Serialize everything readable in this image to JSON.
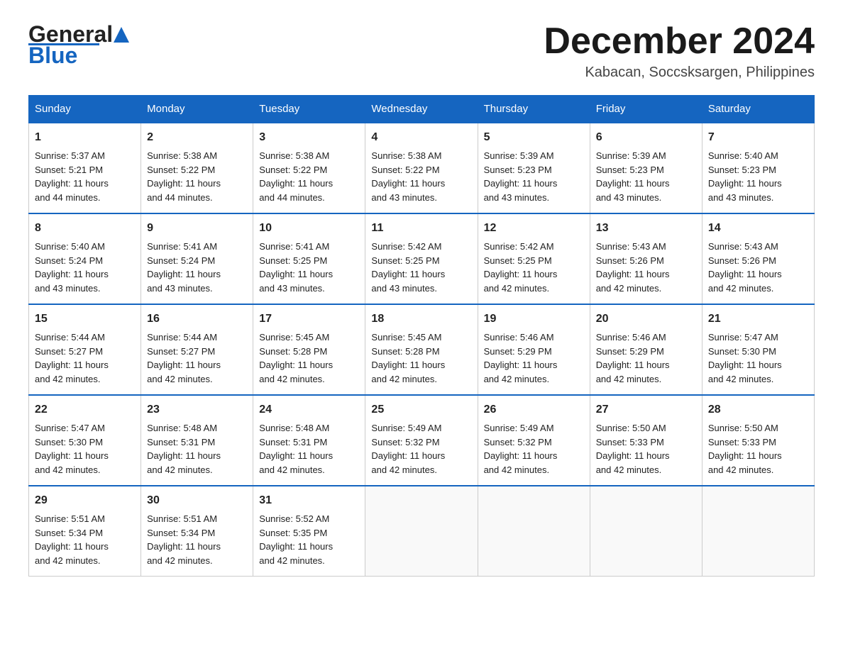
{
  "header": {
    "logo_general": "General",
    "logo_blue": "Blue",
    "month_title": "December 2024",
    "location": "Kabacan, Soccsksargen, Philippines"
  },
  "days_of_week": [
    "Sunday",
    "Monday",
    "Tuesday",
    "Wednesday",
    "Thursday",
    "Friday",
    "Saturday"
  ],
  "weeks": [
    [
      {
        "day": "1",
        "sunrise": "5:37 AM",
        "sunset": "5:21 PM",
        "daylight": "11 hours and 44 minutes."
      },
      {
        "day": "2",
        "sunrise": "5:38 AM",
        "sunset": "5:22 PM",
        "daylight": "11 hours and 44 minutes."
      },
      {
        "day": "3",
        "sunrise": "5:38 AM",
        "sunset": "5:22 PM",
        "daylight": "11 hours and 44 minutes."
      },
      {
        "day": "4",
        "sunrise": "5:38 AM",
        "sunset": "5:22 PM",
        "daylight": "11 hours and 43 minutes."
      },
      {
        "day": "5",
        "sunrise": "5:39 AM",
        "sunset": "5:23 PM",
        "daylight": "11 hours and 43 minutes."
      },
      {
        "day": "6",
        "sunrise": "5:39 AM",
        "sunset": "5:23 PM",
        "daylight": "11 hours and 43 minutes."
      },
      {
        "day": "7",
        "sunrise": "5:40 AM",
        "sunset": "5:23 PM",
        "daylight": "11 hours and 43 minutes."
      }
    ],
    [
      {
        "day": "8",
        "sunrise": "5:40 AM",
        "sunset": "5:24 PM",
        "daylight": "11 hours and 43 minutes."
      },
      {
        "day": "9",
        "sunrise": "5:41 AM",
        "sunset": "5:24 PM",
        "daylight": "11 hours and 43 minutes."
      },
      {
        "day": "10",
        "sunrise": "5:41 AM",
        "sunset": "5:25 PM",
        "daylight": "11 hours and 43 minutes."
      },
      {
        "day": "11",
        "sunrise": "5:42 AM",
        "sunset": "5:25 PM",
        "daylight": "11 hours and 43 minutes."
      },
      {
        "day": "12",
        "sunrise": "5:42 AM",
        "sunset": "5:25 PM",
        "daylight": "11 hours and 42 minutes."
      },
      {
        "day": "13",
        "sunrise": "5:43 AM",
        "sunset": "5:26 PM",
        "daylight": "11 hours and 42 minutes."
      },
      {
        "day": "14",
        "sunrise": "5:43 AM",
        "sunset": "5:26 PM",
        "daylight": "11 hours and 42 minutes."
      }
    ],
    [
      {
        "day": "15",
        "sunrise": "5:44 AM",
        "sunset": "5:27 PM",
        "daylight": "11 hours and 42 minutes."
      },
      {
        "day": "16",
        "sunrise": "5:44 AM",
        "sunset": "5:27 PM",
        "daylight": "11 hours and 42 minutes."
      },
      {
        "day": "17",
        "sunrise": "5:45 AM",
        "sunset": "5:28 PM",
        "daylight": "11 hours and 42 minutes."
      },
      {
        "day": "18",
        "sunrise": "5:45 AM",
        "sunset": "5:28 PM",
        "daylight": "11 hours and 42 minutes."
      },
      {
        "day": "19",
        "sunrise": "5:46 AM",
        "sunset": "5:29 PM",
        "daylight": "11 hours and 42 minutes."
      },
      {
        "day": "20",
        "sunrise": "5:46 AM",
        "sunset": "5:29 PM",
        "daylight": "11 hours and 42 minutes."
      },
      {
        "day": "21",
        "sunrise": "5:47 AM",
        "sunset": "5:30 PM",
        "daylight": "11 hours and 42 minutes."
      }
    ],
    [
      {
        "day": "22",
        "sunrise": "5:47 AM",
        "sunset": "5:30 PM",
        "daylight": "11 hours and 42 minutes."
      },
      {
        "day": "23",
        "sunrise": "5:48 AM",
        "sunset": "5:31 PM",
        "daylight": "11 hours and 42 minutes."
      },
      {
        "day": "24",
        "sunrise": "5:48 AM",
        "sunset": "5:31 PM",
        "daylight": "11 hours and 42 minutes."
      },
      {
        "day": "25",
        "sunrise": "5:49 AM",
        "sunset": "5:32 PM",
        "daylight": "11 hours and 42 minutes."
      },
      {
        "day": "26",
        "sunrise": "5:49 AM",
        "sunset": "5:32 PM",
        "daylight": "11 hours and 42 minutes."
      },
      {
        "day": "27",
        "sunrise": "5:50 AM",
        "sunset": "5:33 PM",
        "daylight": "11 hours and 42 minutes."
      },
      {
        "day": "28",
        "sunrise": "5:50 AM",
        "sunset": "5:33 PM",
        "daylight": "11 hours and 42 minutes."
      }
    ],
    [
      {
        "day": "29",
        "sunrise": "5:51 AM",
        "sunset": "5:34 PM",
        "daylight": "11 hours and 42 minutes."
      },
      {
        "day": "30",
        "sunrise": "5:51 AM",
        "sunset": "5:34 PM",
        "daylight": "11 hours and 42 minutes."
      },
      {
        "day": "31",
        "sunrise": "5:52 AM",
        "sunset": "5:35 PM",
        "daylight": "11 hours and 42 minutes."
      },
      null,
      null,
      null,
      null
    ]
  ],
  "labels": {
    "sunrise": "Sunrise:",
    "sunset": "Sunset:",
    "daylight": "Daylight:"
  }
}
